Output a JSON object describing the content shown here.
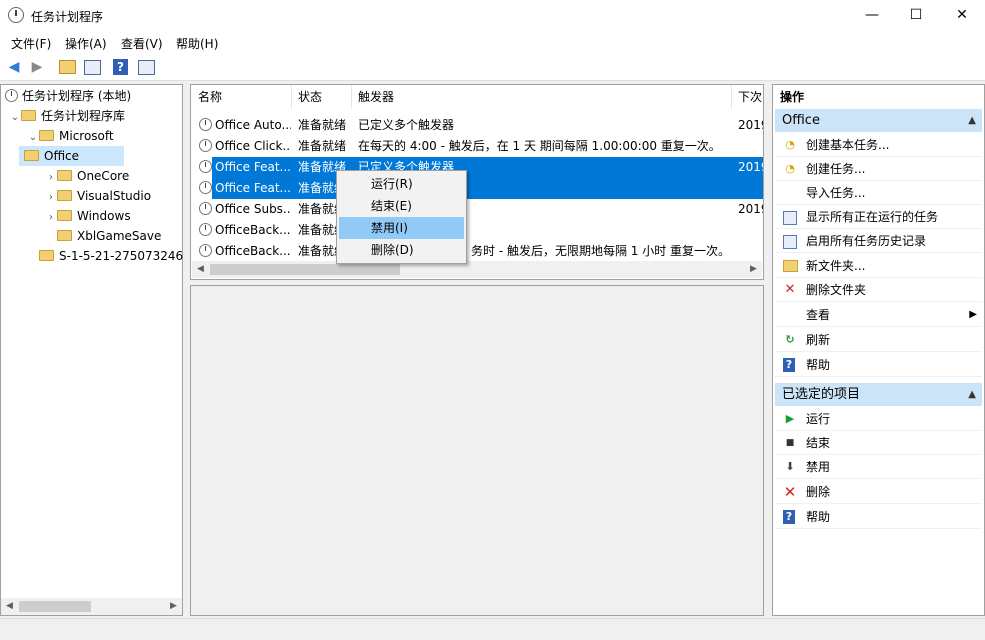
{
  "window": {
    "title": "任务计划程序",
    "min": "—",
    "max": "☐",
    "close": "✕"
  },
  "menu": [
    "文件(F)",
    "操作(A)",
    "查看(V)",
    "帮助(H)"
  ],
  "tree": {
    "root": "任务计划程序 (本地)",
    "library": "任务计划程序库",
    "microsoft": "Microsoft",
    "children": [
      "Office",
      "OneCore",
      "VisualStudio",
      "Windows",
      "XblGameSave"
    ],
    "sid": "S-1-5-21-275073246"
  },
  "list": {
    "columns": [
      "名称",
      "状态",
      "触发器",
      "下次"
    ],
    "rows": [
      {
        "name": "Office Auto...",
        "status": "准备就绪",
        "trigger": "已定义多个触发器",
        "next": "2019"
      },
      {
        "name": "Office Click...",
        "status": "准备就绪",
        "trigger": "在每天的 4:00 - 触发后，在 1 天 期间每隔 1.00:00:00 重复一次。",
        "next": ""
      },
      {
        "name": "Office Feat...",
        "status": "准备就绪",
        "trigger": "已定义多个触发器",
        "next": "2019"
      },
      {
        "name": "Office Feat...",
        "status": "准备就绪",
        "trigger": "",
        "next": ""
      },
      {
        "name": "Office Subs...",
        "status": "准备就绪",
        "trigger": "",
        "next": "2019"
      },
      {
        "name": "OfficeBack...",
        "status": "准备就绪",
        "trigger": "",
        "next": ""
      },
      {
        "name": "OfficeBack...",
        "status": "准备就绪",
        "trigger": "务时 - 触发后，无限期地每隔 1 小时 重复一次。",
        "next": ""
      }
    ]
  },
  "context_menu": [
    "运行(R)",
    "结束(E)",
    "禁用(I)",
    "删除(D)"
  ],
  "actions": {
    "title": "操作",
    "office_header": "Office",
    "office_items": [
      "创建基本任务...",
      "创建任务...",
      "导入任务...",
      "显示所有正在运行的任务",
      "启用所有任务历史记录",
      "新文件夹...",
      "删除文件夹",
      "查看",
      "刷新",
      "帮助"
    ],
    "selected_header": "已选定的项目",
    "selected_items": [
      "运行",
      "结束",
      "禁用",
      "删除",
      "帮助"
    ]
  },
  "colors": {
    "selection": "#0078d7",
    "menu_highlight": "#91c9f7",
    "section_header": "#cce4f7"
  }
}
